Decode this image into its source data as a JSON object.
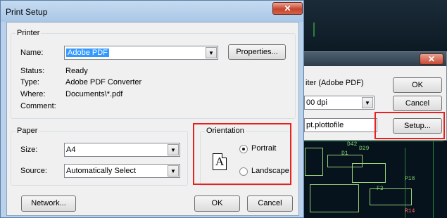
{
  "print_setup": {
    "title": "Print Setup",
    "close_icon": "close-icon",
    "printer": {
      "group_label": "Printer",
      "name_label": "Name:",
      "name_value": "Adobe PDF",
      "properties_label": "Properties...",
      "status_label": "Status:",
      "status_value": "Ready",
      "type_label": "Type:",
      "type_value": "Adobe PDF Converter",
      "where_label": "Where:",
      "where_value": "Documents\\*.pdf",
      "comment_label": "Comment:",
      "comment_value": ""
    },
    "paper": {
      "group_label": "Paper",
      "size_label": "Size:",
      "size_value": "A4",
      "source_label": "Source:",
      "source_value": "Automatically Select"
    },
    "orientation": {
      "group_label": "Orientation",
      "icon_letter": "A",
      "portrait_label": "Portrait",
      "landscape_label": "Landscape",
      "selected": "portrait"
    },
    "buttons": {
      "network": "Network...",
      "ok": "OK",
      "cancel": "Cancel"
    }
  },
  "background_dialog": {
    "printer_text": "iter (Adobe PDF)",
    "dpi_value": "00 dpi",
    "file_value": "pt.plottofile",
    "ok": "OK",
    "cancel": "Cancel",
    "setup": "Setup..."
  },
  "pcb_labels": [
    "D1",
    "D29",
    "D42",
    "F3",
    "R14",
    "P18"
  ],
  "colors": {
    "highlight": "#e8201e",
    "title_bar": "#b9d1ea",
    "selection": "#3399ff"
  }
}
